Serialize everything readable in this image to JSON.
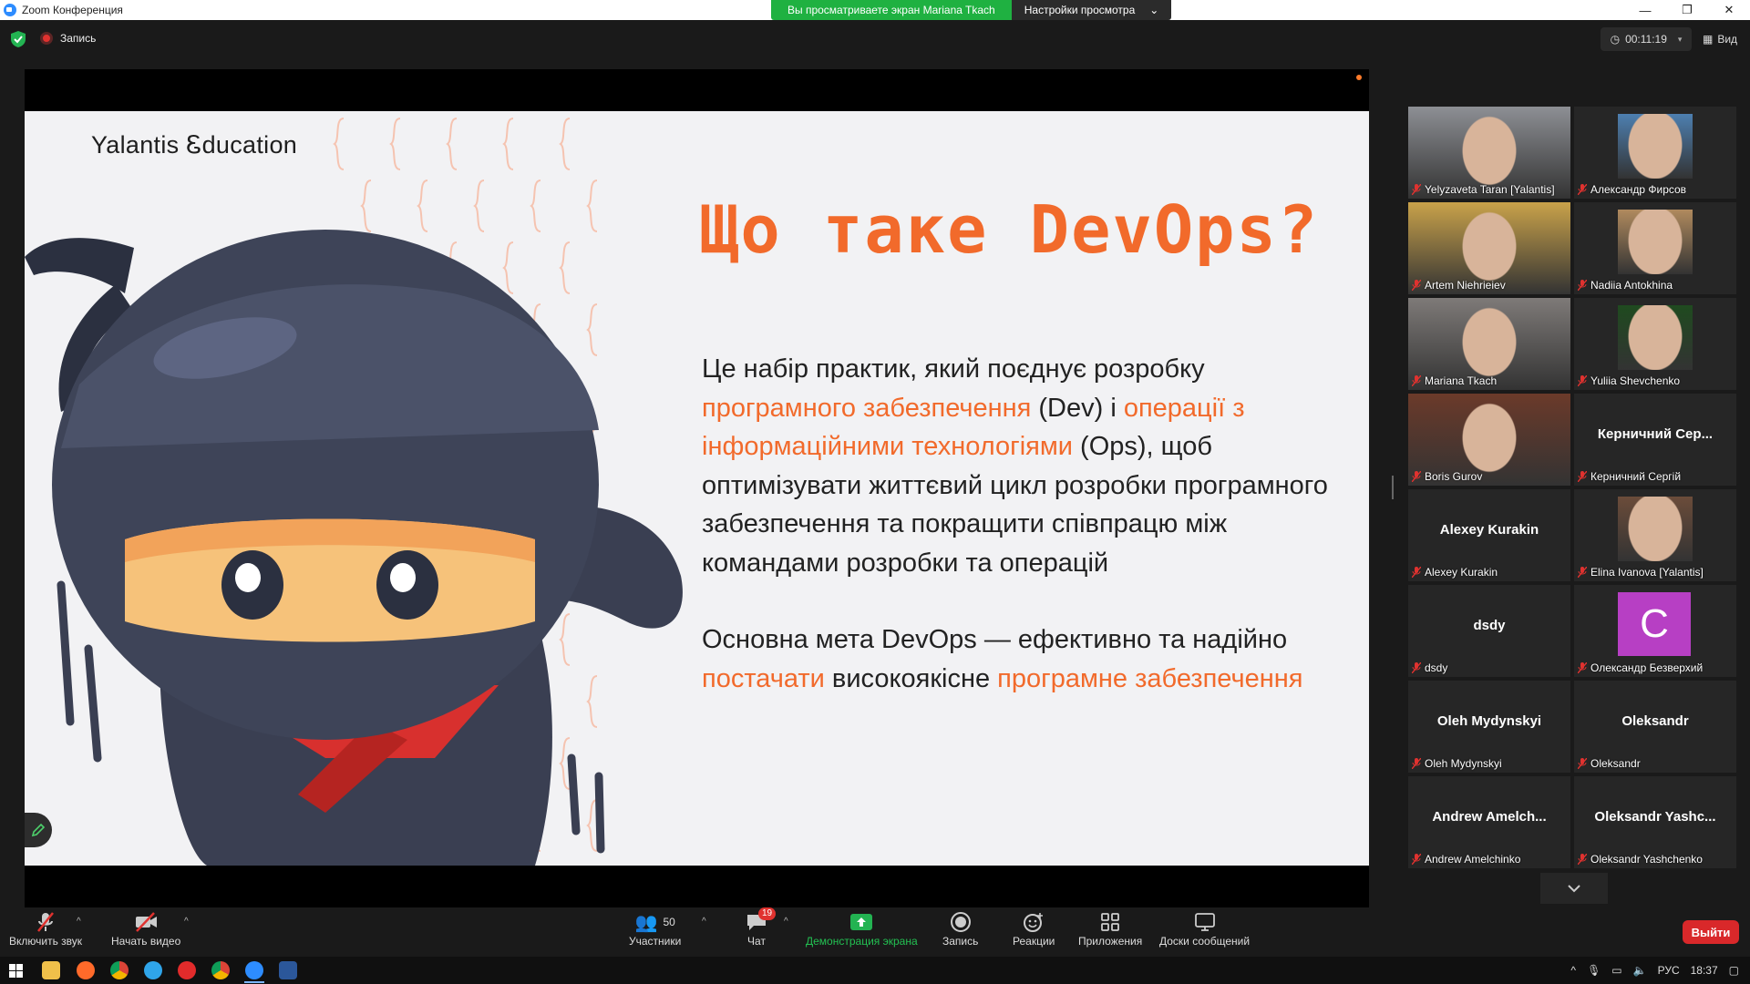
{
  "window": {
    "title": "Zoom Конференция"
  },
  "banner": {
    "viewing_text": "Вы просматриваете экран Mariana Tkach",
    "view_options_label": "Настройки просмотра"
  },
  "topbar": {
    "recording_label": "Запись",
    "timer": "00:11:19",
    "view_label": "Вид"
  },
  "slide": {
    "brand": "Yalantis Ꮛducation",
    "title": "Що таке DevOps?",
    "p1_a": "Це набір практик, який поєднує розробку ",
    "p1_b": "програмного забезпечення",
    "p1_c": " (Dev) і ",
    "p1_d": "операції з інформаційними технологіями",
    "p1_e": " (Ops), щоб оптимізувати життєвий цикл розробки програмного забезпечення та покращити співпрацю між командами розробки та операцій",
    "p2_a": "Основна мета DevOps — ефективно та надійно ",
    "p2_b": "постачати",
    "p2_c": " високоякісне ",
    "p2_d": "програмне забезпечення",
    "accent_color": "#f26a2b"
  },
  "participants": [
    {
      "name": "Yelyzaveta Taran [Yalantis]",
      "type": "video"
    },
    {
      "name": "Александр Фирсов",
      "type": "video"
    },
    {
      "name": "Artem Niehrieiev",
      "type": "video"
    },
    {
      "name": "Nadiia Antokhina",
      "type": "video"
    },
    {
      "name": "Mariana Tkach",
      "type": "video",
      "active": true
    },
    {
      "name": "Yuliia Shevchenko",
      "type": "video"
    },
    {
      "name": "Boris Gurov",
      "type": "video"
    },
    {
      "name": "Керничний Сергій",
      "display": "Керничний Сер...",
      "type": "name"
    },
    {
      "name": "Alexey Kurakin",
      "display": "Alexey Kurakin",
      "type": "name"
    },
    {
      "name": "Elina Ivanova [Yalantis]",
      "type": "video"
    },
    {
      "name": "dsdy",
      "display": "dsdy",
      "type": "name"
    },
    {
      "name": "Олександр Безверхий",
      "avatar_letter": "C",
      "type": "avatar"
    },
    {
      "name": "Oleh Mydynskyi",
      "display": "Oleh Mydynskyi",
      "type": "name"
    },
    {
      "name": "Oleksandr",
      "display": "Oleksandr",
      "type": "name"
    },
    {
      "name": "Andrew Amelchinko",
      "display": "Andrew Amelch...",
      "type": "name"
    },
    {
      "name": "Oleksandr Yashchenko",
      "display": "Oleksandr Yashc...",
      "type": "name"
    }
  ],
  "toolbar": {
    "unmute": "Включить звук",
    "start_video": "Начать видео",
    "participants": "Участники",
    "participants_count": "50",
    "chat": "Чат",
    "chat_badge": "19",
    "share": "Демонстрация экрана",
    "record": "Запись",
    "reactions": "Реакции",
    "apps": "Приложения",
    "whiteboards": "Доски сообщений",
    "leave": "Выйти"
  },
  "taskbar": {
    "lang": "РУС",
    "time": "18:37"
  },
  "icons": [
    "shield-icon",
    "record-icon",
    "clock-icon",
    "grid-view-icon",
    "mic-off-icon",
    "video-off-icon",
    "participants-icon",
    "chat-icon",
    "share-screen-icon",
    "record-button-icon",
    "reactions-icon",
    "apps-icon",
    "whiteboard-icon",
    "pen-icon",
    "chevron-down-icon"
  ]
}
